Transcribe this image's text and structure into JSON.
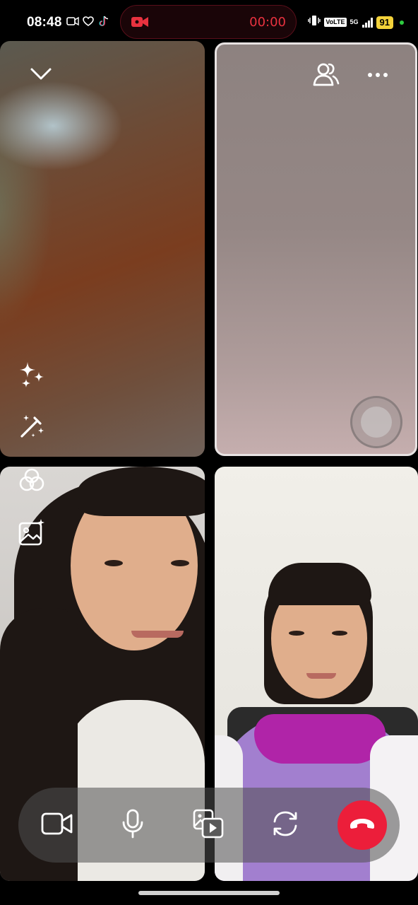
{
  "status_bar": {
    "time": "08:48",
    "left_icons": [
      "screen-record-indicator-icon",
      "heart-icon",
      "tiktok-icon"
    ],
    "recording_timer": "00:00",
    "right_icons": [
      "vibrate-icon",
      "volte-icon",
      "5g-icon",
      "signal-icon"
    ],
    "volte_label": "VoLTE",
    "network_label": "5G",
    "battery_level": "91",
    "colors": {
      "recording": "#e8323f",
      "battery": "#f3d23a",
      "dot": "#2ecc40"
    }
  },
  "call": {
    "participants": [
      {
        "tile": "top-left",
        "video": "dark-brown-blurred"
      },
      {
        "tile": "top-right",
        "video": "gray-pink-blurred",
        "active_speaker": true
      },
      {
        "tile": "bottom-left",
        "video": "girl-long-hair"
      },
      {
        "tile": "bottom-right",
        "video": "girl-purple-uniform"
      }
    ],
    "overlay_icons": {
      "collapse": "chevron-down-icon",
      "people": "participants-icon",
      "more": "more-options-icon",
      "effects": "sparkles-icon",
      "magic": "magic-wand-icon",
      "filters": "filters-icon",
      "background": "image-sparkle-icon"
    },
    "controls": [
      "camera-icon",
      "microphone-icon",
      "media-share-icon",
      "flip-camera-icon",
      "end-call-icon"
    ],
    "colors": {
      "end_call": "#ec1e3a",
      "control_bar": "#505050"
    }
  }
}
